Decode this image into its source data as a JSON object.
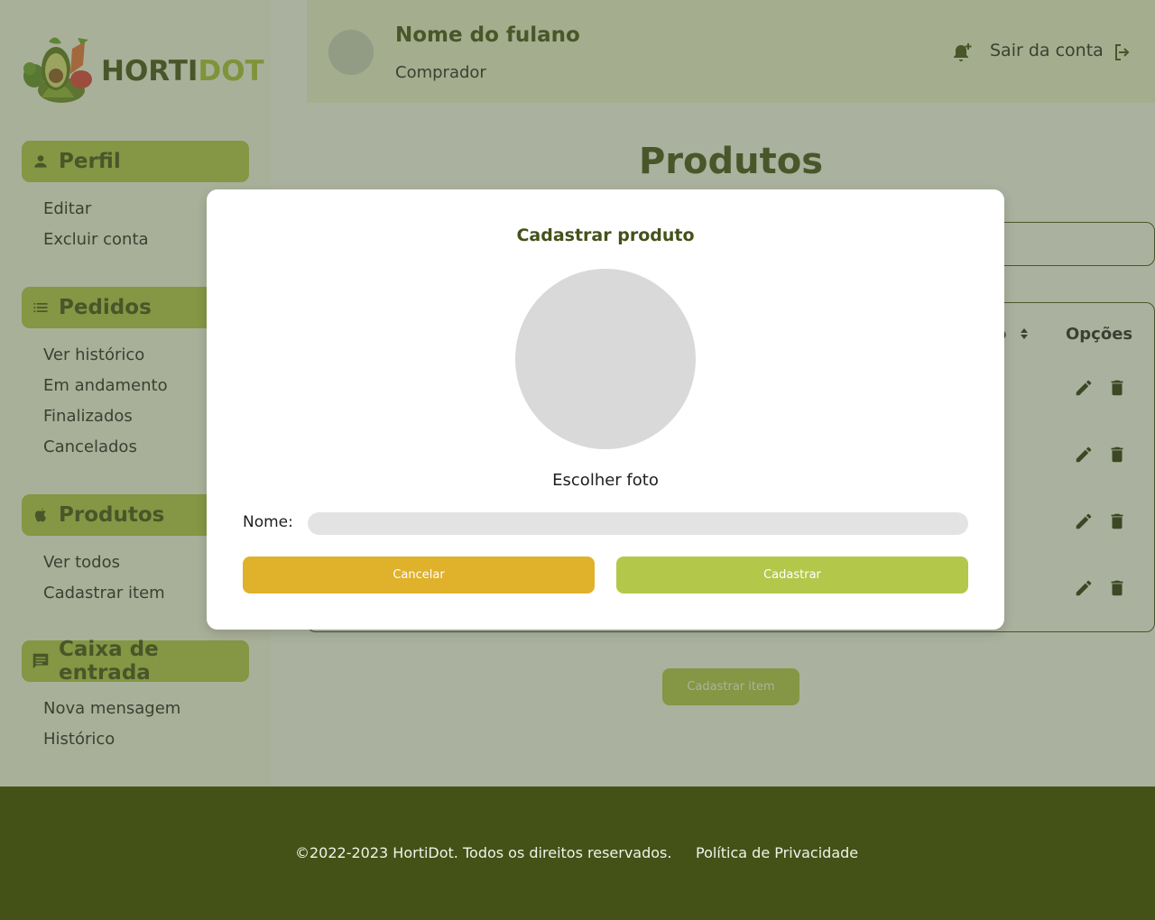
{
  "brand": {
    "part1": "HORTI",
    "part2": "DOT",
    "color_dark": "#44521a",
    "color_accent": "#a7c23a"
  },
  "sidebar": {
    "sections": [
      {
        "title": "Perfil",
        "icon": "person-icon",
        "items": [
          "Editar",
          "Excluir conta"
        ]
      },
      {
        "title": "Pedidos",
        "icon": "list-icon",
        "items": [
          "Ver histórico",
          "Em andamento",
          "Finalizados",
          "Cancelados"
        ]
      },
      {
        "title": "Produtos",
        "icon": "apple-icon",
        "items": [
          "Ver todos",
          "Cadastrar item"
        ]
      },
      {
        "title": "Caixa de entrada",
        "icon": "chat-icon",
        "items": [
          "Nova mensagem",
          "Histórico"
        ]
      }
    ]
  },
  "header": {
    "user_name": "Nome do fulano",
    "user_role": "Comprador",
    "logout_label": "Sair da conta"
  },
  "main": {
    "title": "Produtos",
    "table": {
      "sort_column_tail": "o",
      "options_header": "Opções",
      "row_count": 4
    },
    "add_button": "Cadastrar item"
  },
  "modal": {
    "title": "Cadastrar produto",
    "choose_photo": "Escolher foto",
    "name_label": "Nome:",
    "name_value": "",
    "cancel_label": "Cancelar",
    "submit_label": "Cadastrar"
  },
  "footer": {
    "copyright": "©2022-2023 HortiDot. Todos os direitos reservados.",
    "policy": "Política de Privacidade"
  },
  "colors": {
    "section_bg": "#b1c74b",
    "cancel": "#e0b12a",
    "submit": "#b3c84a",
    "footer": "#445217"
  }
}
